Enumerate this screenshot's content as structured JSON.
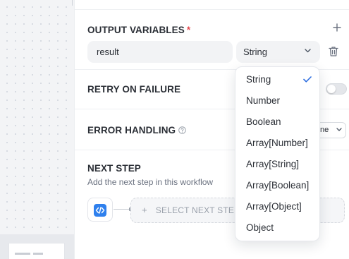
{
  "output_variables": {
    "title": "OUTPUT VARIABLES",
    "required_mark": "*",
    "add_icon": "plus-icon",
    "variable_name": "result",
    "type_selected": "String",
    "delete_icon": "trash-icon"
  },
  "retry": {
    "title": "RETRY ON FAILURE",
    "enabled": false
  },
  "error_handling": {
    "title": "ERROR HANDLING",
    "help_icon": "help-circle-icon",
    "value_partial": "ne"
  },
  "next_step": {
    "title": "NEXT STEP",
    "subtitle": "Add the next step in this workflow",
    "node_icon": "code-icon",
    "select_label": "SELECT NEXT STEP"
  },
  "type_dropdown": {
    "selected": "String",
    "options": [
      "String",
      "Number",
      "Boolean",
      "Array[Number]",
      "Array[String]",
      "Array[Boolean]",
      "Array[Object]",
      "Object"
    ]
  },
  "colors": {
    "accent": "#2f80ed",
    "required": "#e5484d"
  }
}
